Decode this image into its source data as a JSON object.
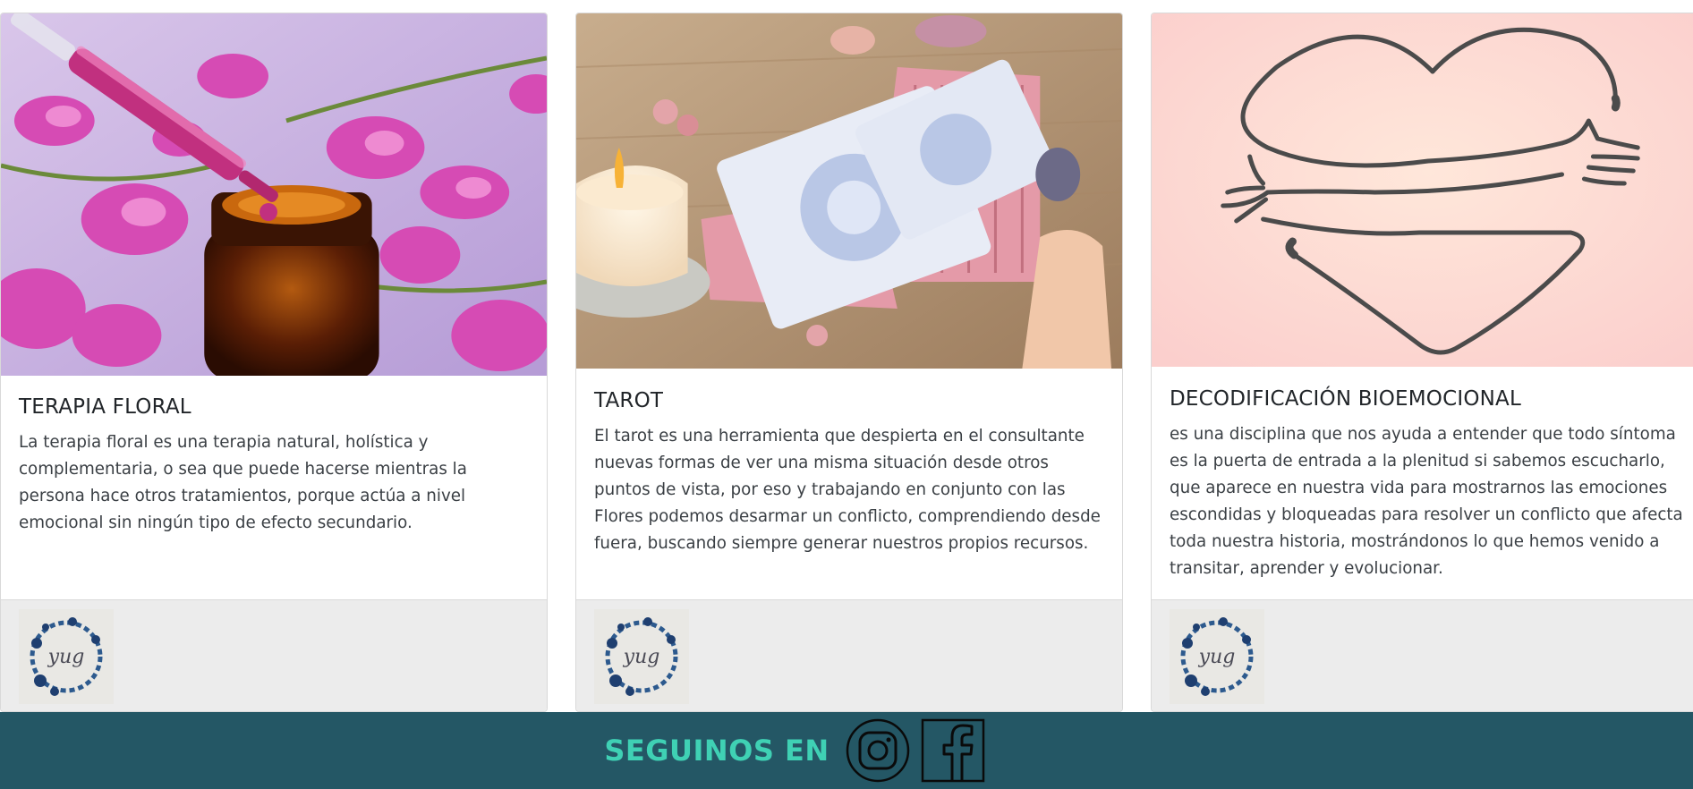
{
  "cards": [
    {
      "title": "TERAPIA FLORAL",
      "text": "La terapia floral es una terapia natural, holística y complementaria, o sea que puede hacerse mientras la persona hace otros tratamientos, porque actúa a nivel emocional sin ningún tipo de efecto secundario.",
      "image": "flower-essence-dropper-image",
      "logo_text": "yug"
    },
    {
      "title": "TAROT",
      "text": "El tarot es una herramienta que despierta en el consultante nuevas formas de ver una misma situación desde otros puntos de vista, por eso y trabajando en conjunto con las Flores podemos desarmar un conflicto, comprendiendo desde fuera, buscando siempre generar nuestros propios recursos.",
      "image": "tarot-cards-candle-image",
      "logo_text": "yug"
    },
    {
      "title": "DECODIFICACIÓN BIOEMOCIONAL",
      "text": "es una disciplina que nos ayuda a entender que todo síntoma es la puerta de entrada a la plenitud si sabemos escucharlo, que aparece en nuestra vida para mostrarnos las emociones escondidas y bloqueadas para resolver un conflicto que afecta toda nuestra historia, mostrándonos lo que hemos venido a transitar, aprender y evolucionar.",
      "image": "heart-hug-illustration",
      "logo_text": "yug"
    }
  ],
  "footer": {
    "follow_text": "SEGUINOS EN",
    "icons": [
      "instagram-icon",
      "facebook-icon"
    ]
  },
  "colors": {
    "footer_bg": "#245765",
    "follow_text": "#3fd1b4",
    "card_footer_bg": "#ececec"
  }
}
